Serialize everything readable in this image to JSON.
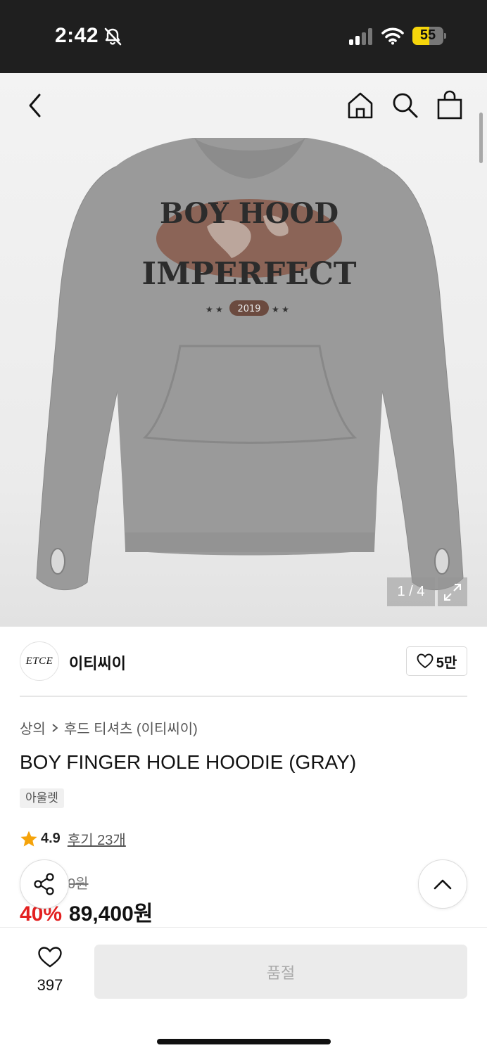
{
  "status_bar": {
    "time": "2:42",
    "battery_level": "55",
    "battery_fraction": 0.55,
    "icons": [
      "bell-slash-icon",
      "signal-icon",
      "wifi-icon",
      "battery-icon"
    ]
  },
  "nav": {
    "icons": [
      "back-icon",
      "home-icon",
      "search-icon",
      "shopping-bag-icon"
    ]
  },
  "gallery": {
    "counter": "1 / 4",
    "print_line1": "BOY HOOD",
    "print_line2": "IMPERFECT",
    "print_year": "2019",
    "garment_color": "#9a9a9a",
    "print_color": "#8a5e50"
  },
  "brand": {
    "logo_text": "ETCE",
    "name": "이티씨이",
    "likes": "5만"
  },
  "product": {
    "breadcrumb": [
      "상의",
      "후드 티셔츠 (이티씨이)"
    ],
    "title": "BOY FINGER HOLE HOODIE (GRAY)",
    "tag": "아울렛",
    "rating": "4.9",
    "reviews": "후기 23개",
    "original_price": "0원",
    "discount": "40%",
    "price": "89,400원"
  },
  "bottom_bar": {
    "wish_count": "397",
    "cta_label": "품절"
  },
  "colors": {
    "discount_red": "#e32020",
    "star_orange": "#f5a30a",
    "battery_yellow": "#f5d50b"
  }
}
